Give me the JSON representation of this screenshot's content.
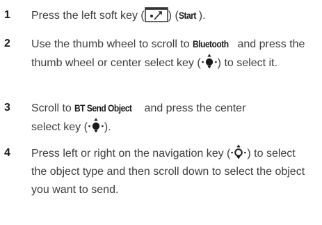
{
  "steps": [
    {
      "num": "1",
      "t1": "Press the left soft key (",
      "t2": ") (",
      "kw": "Start",
      "t3": ").",
      "icon": "soft-key-icon"
    },
    {
      "num": "2",
      "t1": "Use the thumb wheel to scroll to ",
      "kw": "Bluetooth",
      "t2": " and press the thumb wheel or center select key (",
      "t3": ") to select it.",
      "icon": "center-select-key-icon"
    },
    {
      "num": "3",
      "t1": "Scroll to ",
      "kw": "BT Send Object",
      "t2": " and press the center select key (",
      "t3": ").",
      "icon": "center-select-key-icon"
    },
    {
      "num": "4",
      "t1": "Press left or right on the navigation key (",
      "t2": ") to select the object type and then scroll down to select the object you want to send.",
      "icon": "navigation-key-icon"
    }
  ]
}
